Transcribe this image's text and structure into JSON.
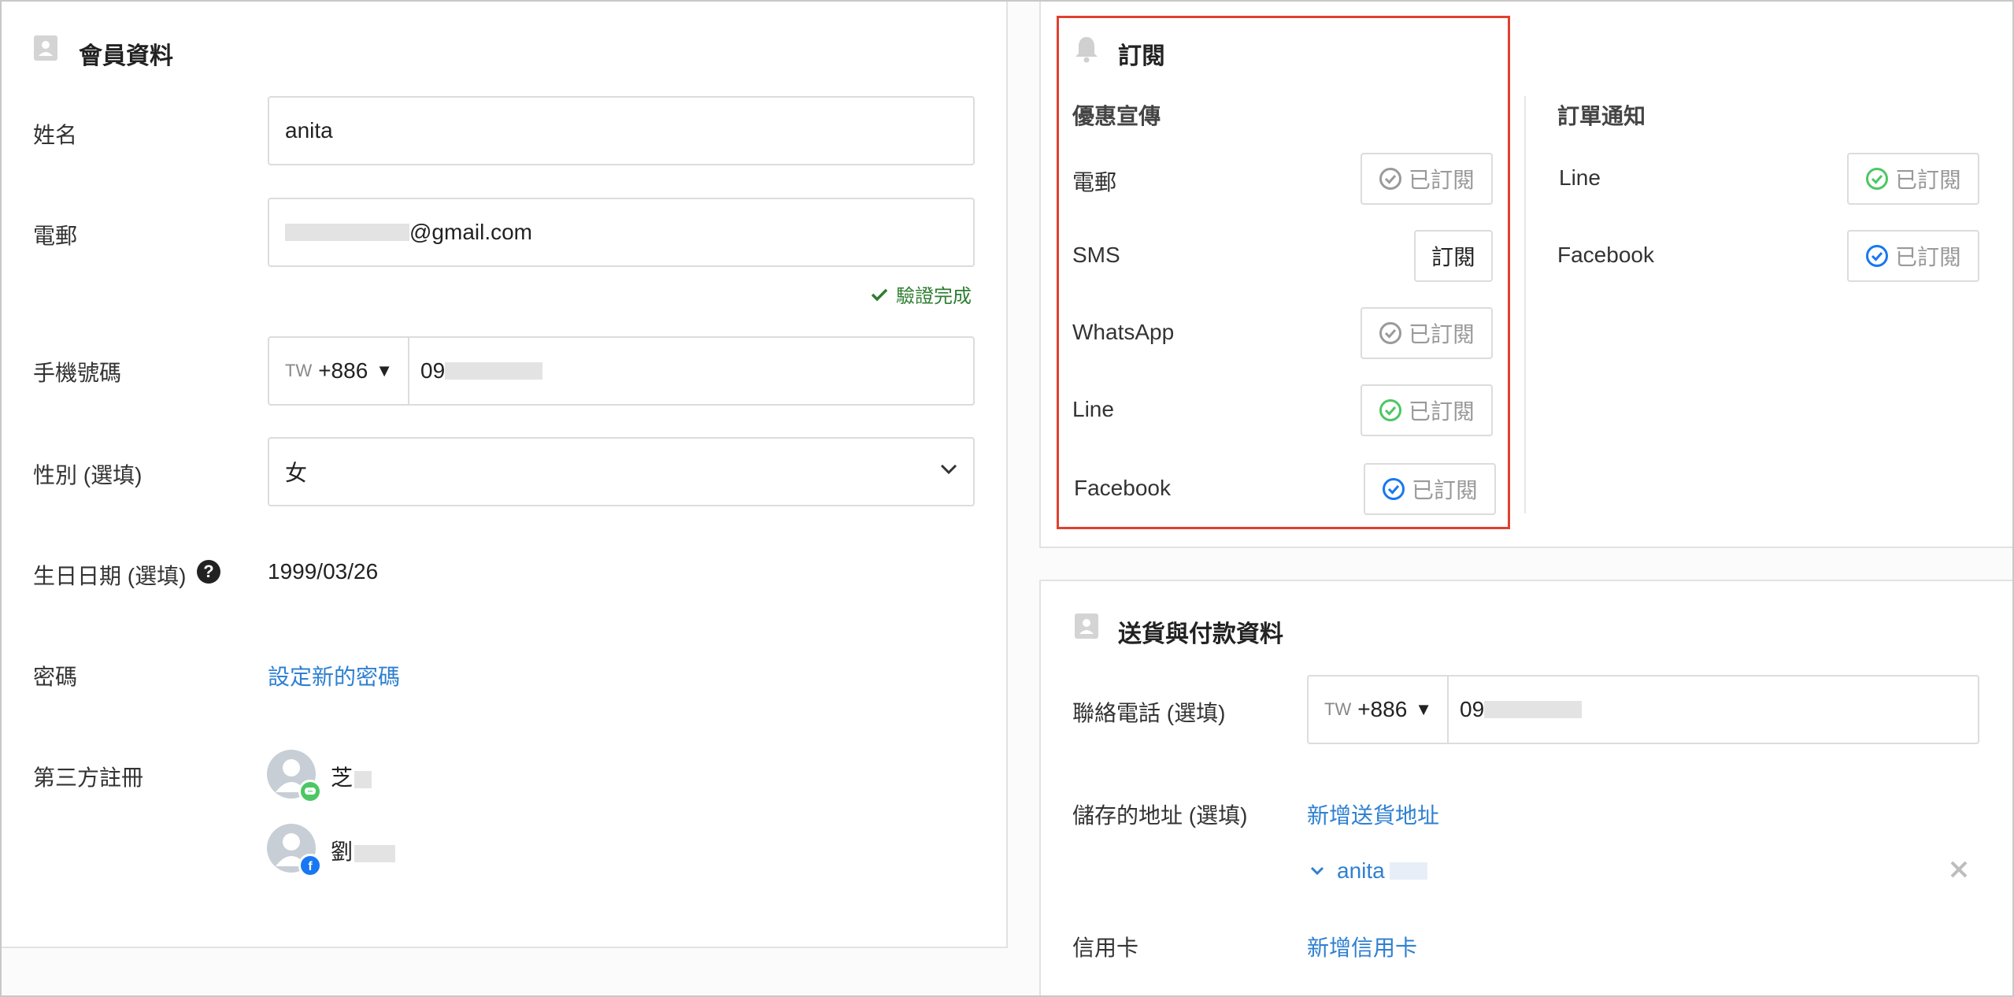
{
  "member": {
    "title": "會員資料",
    "name_label": "姓名",
    "name_value": "anita",
    "email_label": "電郵",
    "email_suffix": "@gmail.com",
    "verified_text": "驗證完成",
    "mobile_label": "手機號碼",
    "mobile_country": "TW",
    "mobile_code": "+886",
    "mobile_prefix": "09",
    "gender_label": "性別 (選填)",
    "gender_value": "女",
    "birthday_label": "生日日期 (選填)",
    "birthday_value": "1999/03/26",
    "password_label": "密碼",
    "password_link": "設定新的密碼",
    "third_party_label": "第三方註冊",
    "third_party": [
      {
        "name": "芝",
        "service": "line-icon"
      },
      {
        "name": "劉",
        "service": "facebook-icon"
      }
    ]
  },
  "subscription": {
    "title": "訂閱",
    "promo_title": "優惠宣傳",
    "promo_items": [
      {
        "label": "電郵",
        "button": "已訂閱",
        "state": "subscribed",
        "icon": "check-circle-gray"
      },
      {
        "label": "SMS",
        "button": "訂閱",
        "state": "unsubscribed",
        "icon": ""
      },
      {
        "label": "WhatsApp",
        "button": "已訂閱",
        "state": "subscribed",
        "icon": "check-circle-gray"
      },
      {
        "label": "Line",
        "button": "已訂閱",
        "state": "subscribed",
        "icon": "check-circle-green"
      },
      {
        "label": "Facebook",
        "button": "已訂閱",
        "state": "subscribed",
        "icon": "check-circle-blue"
      }
    ],
    "order_title": "訂單通知",
    "order_items": [
      {
        "label": "Line",
        "button": "已訂閱",
        "state": "subscribed",
        "icon": "check-circle-green"
      },
      {
        "label": "Facebook",
        "button": "已訂閱",
        "state": "subscribed",
        "icon": "check-circle-blue"
      }
    ]
  },
  "delivery": {
    "title": "送貨與付款資料",
    "phone_label": "聯絡電話 (選填)",
    "phone_country": "TW",
    "phone_code": "+886",
    "phone_prefix": "09",
    "address_label": "儲存的地址 (選填)",
    "address_link": "新增送貨地址",
    "saved_address_name": "anita",
    "card_label": "信用卡",
    "card_link": "新增信用卡"
  },
  "colors": {
    "accent_link": "#2f80d1",
    "verified_green": "#2e7d32",
    "line_green": "#4cc764",
    "facebook_blue": "#1877f2",
    "highlight_red": "#e0402f"
  }
}
